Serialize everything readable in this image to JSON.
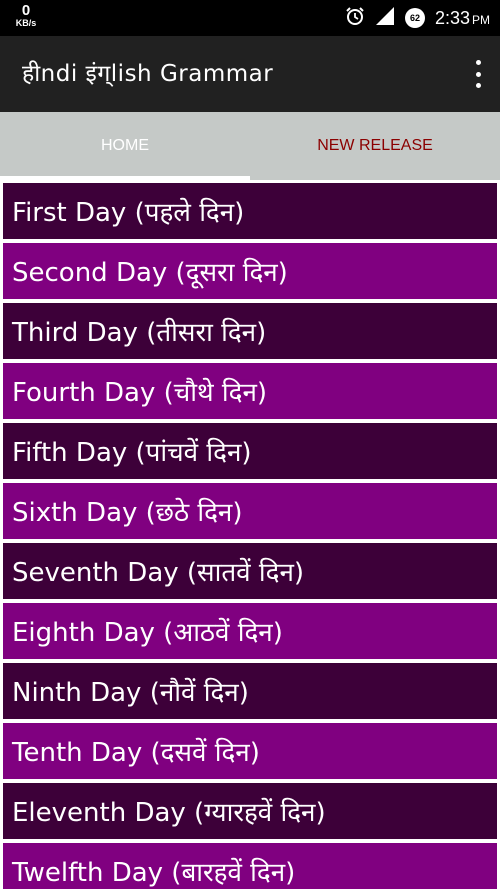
{
  "status_bar": {
    "net_speed_value": "0",
    "net_speed_unit": "KB/s",
    "battery_level": "62",
    "time": "2:33",
    "time_suffix": "PM",
    "icons": [
      "alarm-icon",
      "signal-icon",
      "battery-icon"
    ]
  },
  "app_bar": {
    "title": "हीndi इंग्lish Grammar",
    "menu_icon": "overflow-menu-icon"
  },
  "tabs": [
    {
      "label": "HOME",
      "selected": true
    },
    {
      "label": "NEW RELEASE",
      "selected": false
    }
  ],
  "colors": {
    "status_bar": "#000000",
    "app_bar": "#212121",
    "tab_bar": "#c5c9c7",
    "tab_new_release_text": "#8b0000",
    "row_dark": "#3d0039",
    "row_light": "#800080"
  },
  "days": [
    {
      "label": "First Day (पहले दिन)"
    },
    {
      "label": "Second Day (दूसरा दिन)"
    },
    {
      "label": "Third Day (तीसरा दिन)"
    },
    {
      "label": "Fourth Day (चौथे दिन)"
    },
    {
      "label": "Fifth Day (पांचवें दिन)"
    },
    {
      "label": "Sixth Day (छठे दिन)"
    },
    {
      "label": "Seventh Day (सातवें दिन)"
    },
    {
      "label": "Eighth Day (आठवें दिन)"
    },
    {
      "label": "Ninth Day (नौवें दिन)"
    },
    {
      "label": "Tenth Day (दसवें दिन)"
    },
    {
      "label": "Eleventh Day (ग्यारहवें दिन)"
    },
    {
      "label": "Twelfth Day (बारहवें दिन)"
    }
  ]
}
